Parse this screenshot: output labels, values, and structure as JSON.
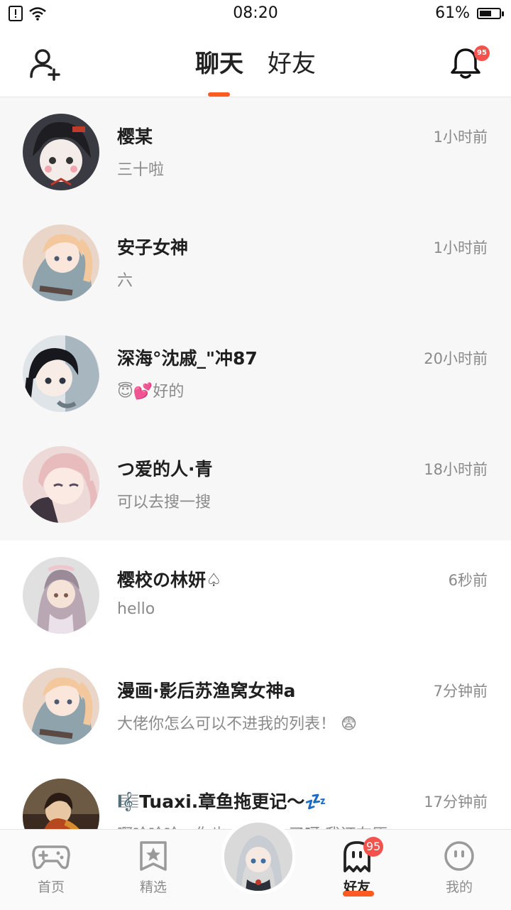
{
  "status_bar": {
    "time": "08:20",
    "battery": "61%",
    "battery_level": 0.61
  },
  "header": {
    "tabs": [
      {
        "label": "聊天",
        "active": true
      },
      {
        "label": "好友",
        "active": false
      }
    ],
    "notification_badge": "95",
    "accent_color": "#ff5a1f"
  },
  "chats": [
    {
      "name": "樱某",
      "preview": "三十啦",
      "time": "1小时前",
      "pinned": true
    },
    {
      "name": "安子女神",
      "preview": "六",
      "time": "1小时前",
      "pinned": true
    },
    {
      "name": "深海°沈戚_\"冲87",
      "preview": "😇💕好的",
      "time": "20小时前",
      "pinned": true
    },
    {
      "name": "つ爱的人·青",
      "preview": "可以去搜一搜",
      "time": "18小时前",
      "pinned": true
    },
    {
      "name": "樱校の林妍♤",
      "preview": "hello",
      "time": "6秒前",
      "pinned": false
    },
    {
      "name": "漫画·影后苏渔窝女神a",
      "preview": "大佬你怎么可以不进我的列表！ 😨",
      "time": "7分钟前",
      "pinned": false
    },
    {
      "name": "🎼Tuaxi.章鱼拖更记～💤",
      "preview": "啊哈哈哈，你也…………了呀 我还在原",
      "time": "17分钟前",
      "pinned": false
    }
  ],
  "bottom_nav": {
    "items": [
      {
        "label": "首页",
        "icon": "gamepad-icon",
        "active": false
      },
      {
        "label": "精选",
        "icon": "star-badge-icon",
        "active": false
      },
      {
        "label": "好友",
        "icon": "ghost-icon",
        "active": true,
        "badge": "95"
      },
      {
        "label": "我的",
        "icon": "smiley-icon",
        "active": false
      }
    ]
  }
}
